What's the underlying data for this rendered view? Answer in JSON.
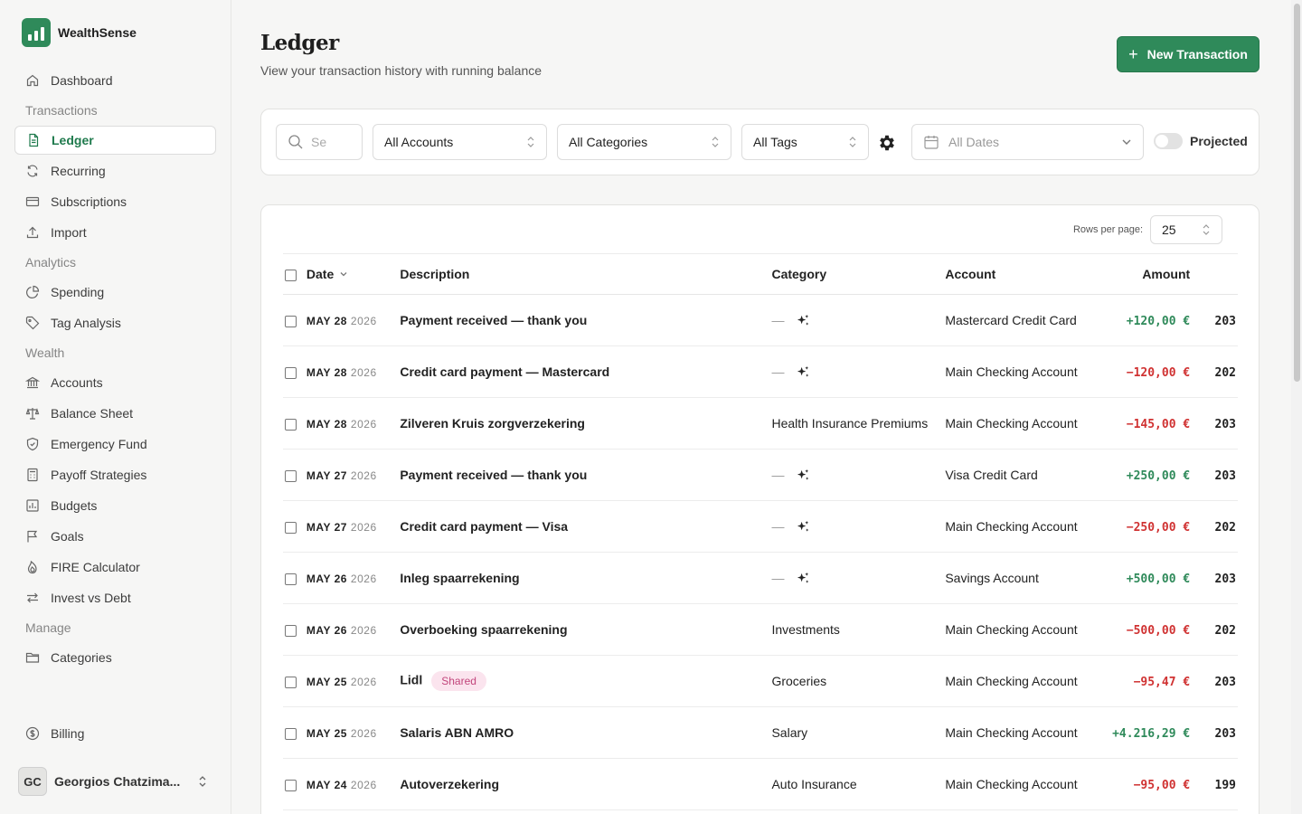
{
  "brand": {
    "name": "WealthSense"
  },
  "nav": {
    "dashboard": "Dashboard",
    "section_transactions": "Transactions",
    "ledger": "Ledger",
    "recurring": "Recurring",
    "subscriptions": "Subscriptions",
    "import": "Import",
    "section_analytics": "Analytics",
    "spending": "Spending",
    "tag_analysis": "Tag Analysis",
    "section_wealth": "Wealth",
    "accounts": "Accounts",
    "balance_sheet": "Balance Sheet",
    "emergency_fund": "Emergency Fund",
    "payoff_strategies": "Payoff Strategies",
    "budgets": "Budgets",
    "goals": "Goals",
    "fire_calculator": "FIRE Calculator",
    "invest_vs_debt": "Invest vs Debt",
    "section_manage": "Manage",
    "categories": "Categories",
    "billing": "Billing"
  },
  "user": {
    "initials": "GC",
    "name": "Georgios Chatzima..."
  },
  "header": {
    "title": "Ledger",
    "subtitle": "View your transaction history with running balance",
    "new_button": "New Transaction"
  },
  "filters": {
    "search_placeholder": "Se",
    "accounts": "All Accounts",
    "categories": "All Categories",
    "tags": "All Tags",
    "dates": "All Dates",
    "projected_label": "Projected"
  },
  "table": {
    "rows_per_page_label": "Rows per page:",
    "rows_per_page_value": "25",
    "headers": {
      "date": "Date",
      "description": "Description",
      "category": "Category",
      "account": "Account",
      "amount": "Amount"
    },
    "rows": [
      {
        "date": "MAY 28",
        "year": "2026",
        "description": "Payment received — thank you",
        "badge": "",
        "category": "",
        "account": "Mastercard Credit Card",
        "amount": "+120,00 €",
        "sign": "pos",
        "balance": "203"
      },
      {
        "date": "MAY 28",
        "year": "2026",
        "description": "Credit card payment — Mastercard",
        "badge": "",
        "category": "",
        "account": "Main Checking Account",
        "amount": "−120,00 €",
        "sign": "neg",
        "balance": "202"
      },
      {
        "date": "MAY 28",
        "year": "2026",
        "description": "Zilveren Kruis zorgverzekering",
        "badge": "",
        "category": "Health Insurance Premiums",
        "account": "Main Checking Account",
        "amount": "−145,00 €",
        "sign": "neg",
        "balance": "203"
      },
      {
        "date": "MAY 27",
        "year": "2026",
        "description": "Payment received — thank you",
        "badge": "",
        "category": "",
        "account": "Visa Credit Card",
        "amount": "+250,00 €",
        "sign": "pos",
        "balance": "203"
      },
      {
        "date": "MAY 27",
        "year": "2026",
        "description": "Credit card payment — Visa",
        "badge": "",
        "category": "",
        "account": "Main Checking Account",
        "amount": "−250,00 €",
        "sign": "neg",
        "balance": "202"
      },
      {
        "date": "MAY 26",
        "year": "2026",
        "description": "Inleg spaarrekening",
        "badge": "",
        "category": "",
        "account": "Savings Account",
        "amount": "+500,00 €",
        "sign": "pos",
        "balance": "203"
      },
      {
        "date": "MAY 26",
        "year": "2026",
        "description": "Overboeking spaarrekening",
        "badge": "",
        "category": "Investments",
        "account": "Main Checking Account",
        "amount": "−500,00 €",
        "sign": "neg",
        "balance": "202"
      },
      {
        "date": "MAY 25",
        "year": "2026",
        "description": "Lidl",
        "badge": "Shared",
        "category": "Groceries",
        "account": "Main Checking Account",
        "amount": "−95,47 €",
        "sign": "neg",
        "balance": "203"
      },
      {
        "date": "MAY 25",
        "year": "2026",
        "description": "Salaris ABN AMRO",
        "badge": "",
        "category": "Salary",
        "account": "Main Checking Account",
        "amount": "+4.216,29 €",
        "sign": "pos",
        "balance": "203"
      },
      {
        "date": "MAY 24",
        "year": "2026",
        "description": "Autoverzekering",
        "badge": "",
        "category": "Auto Insurance",
        "account": "Main Checking Account",
        "amount": "−95,00 €",
        "sign": "neg",
        "balance": "199"
      }
    ]
  },
  "colors": {
    "accent": "#2f8a5a",
    "positive": "#2f8a5a",
    "negative": "#d03232",
    "badge_bg": "#fbe4ee",
    "badge_fg": "#c2457b"
  }
}
